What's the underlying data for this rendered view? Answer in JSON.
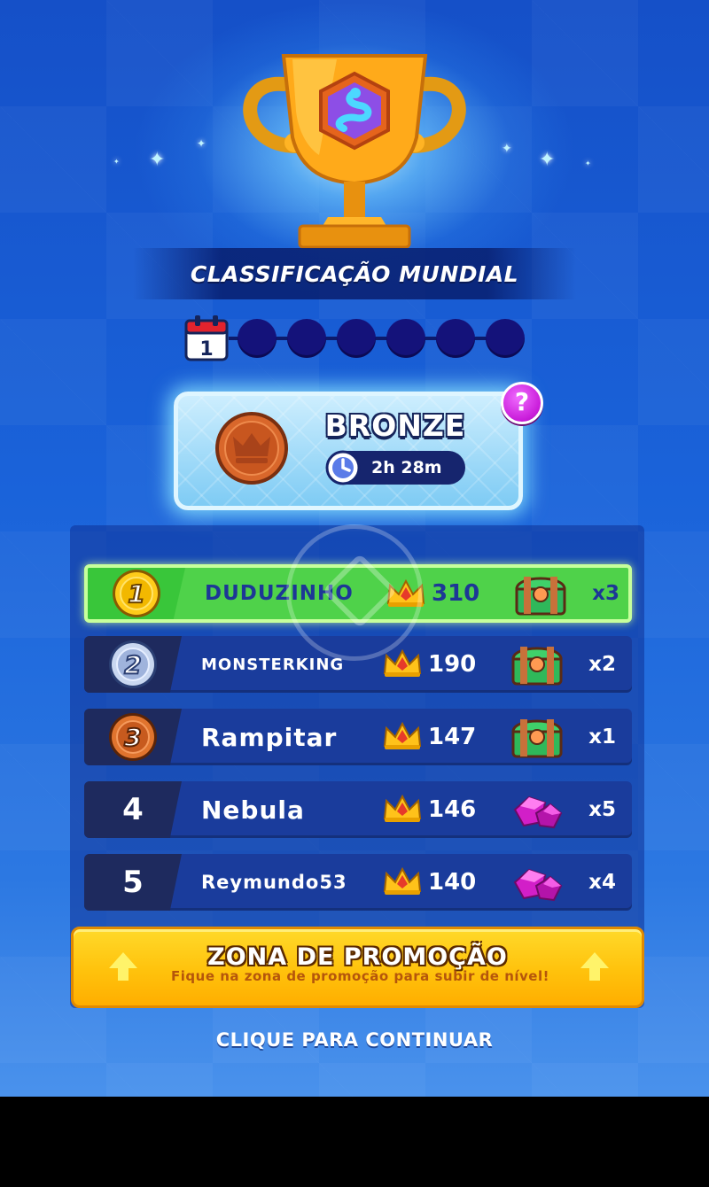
{
  "header": {
    "title": "CLASSIFICAÇÃO MUNDIAL"
  },
  "day_tracker": {
    "current_day": "1",
    "total_days": 7,
    "icon": "calendar-icon"
  },
  "league": {
    "name": "BRONZE",
    "time_left": "2h 28m",
    "help_label": "?",
    "colors": {
      "bronze": "#d9672b",
      "card": "#8fd3f6",
      "help": "#d42be6"
    }
  },
  "leaderboard": {
    "rows": [
      {
        "rank": "1",
        "name": "DUDUZINHO",
        "score": "310",
        "reward_icon": "chest-icon",
        "reward_count": "x3",
        "is_self": true
      },
      {
        "rank": "2",
        "name": "MONSTERKING",
        "score": "190",
        "reward_icon": "chest-icon",
        "reward_count": "x2"
      },
      {
        "rank": "3",
        "name": "Rampitar",
        "score": "147",
        "reward_icon": "chest-icon",
        "reward_count": "x1"
      },
      {
        "rank": "4",
        "name": "Nebula",
        "score": "146",
        "reward_icon": "gem-icon",
        "reward_count": "x5"
      },
      {
        "rank": "5",
        "name": "Reymundo53",
        "score": "140",
        "reward_icon": "gem-icon",
        "reward_count": "x4"
      }
    ]
  },
  "promotion": {
    "title": "ZONA DE PROMOÇÃO",
    "subtitle": "Fique na zona de promoção para subir de nível!"
  },
  "footer": {
    "continue_label": "CLIQUE PARA CONTINUAR"
  }
}
